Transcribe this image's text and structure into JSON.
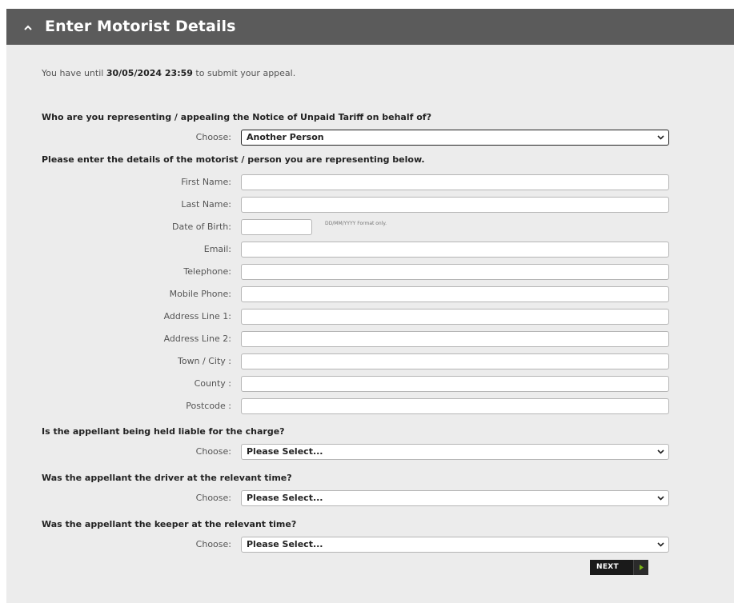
{
  "panel": {
    "title": "Enter Motorist Details",
    "collapse_icon": "chevron-up-icon"
  },
  "deadline": {
    "prefix": "You have until ",
    "date": "30/05/2024 23:59",
    "suffix": " to submit your appeal."
  },
  "representing": {
    "question": "Who are you representing / appealing the Notice of Unpaid Tariff on behalf of?",
    "choose_label": "Choose:",
    "selected": "Another Person"
  },
  "motorist": {
    "heading": "Please enter the details of the motorist / person you are representing below.",
    "fields": {
      "first_name": {
        "label": "First Name:",
        "value": ""
      },
      "last_name": {
        "label": "Last Name:",
        "value": ""
      },
      "dob": {
        "label": "Date of Birth:",
        "value": "",
        "hint": "DD/MM/YYYY Format only."
      },
      "email": {
        "label": "Email:",
        "value": ""
      },
      "telephone": {
        "label": "Telephone:",
        "value": ""
      },
      "mobile": {
        "label": "Mobile Phone:",
        "value": ""
      },
      "address1": {
        "label": "Address Line 1:",
        "value": ""
      },
      "address2": {
        "label": "Address Line 2:",
        "value": ""
      },
      "town": {
        "label": "Town / City :",
        "value": ""
      },
      "county": {
        "label": "County :",
        "value": ""
      },
      "postcode": {
        "label": "Postcode :",
        "value": ""
      }
    }
  },
  "liable": {
    "question": "Is the appellant being held liable for the charge?",
    "choose_label": "Choose:",
    "selected": "Please Select..."
  },
  "driver": {
    "question": "Was the appellant the driver at the relevant time?",
    "choose_label": "Choose:",
    "selected": "Please Select..."
  },
  "keeper": {
    "question": "Was the appellant the keeper at the relevant time?",
    "choose_label": "Choose:",
    "selected": "Please Select..."
  },
  "next_button": {
    "label": "NEXT",
    "icon": "play-arrow-icon",
    "arrow_color": "#7ab317"
  }
}
